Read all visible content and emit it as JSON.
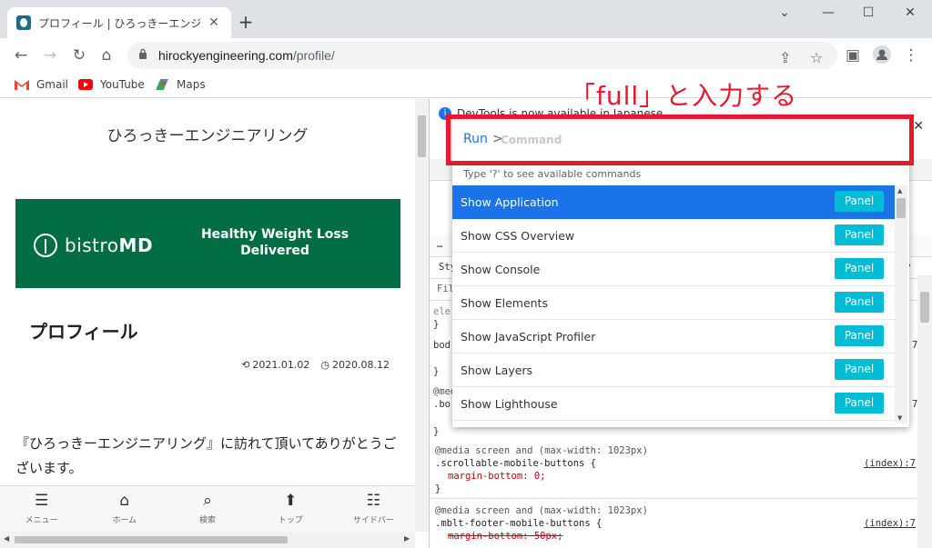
{
  "browser": {
    "tab_title": "プロフィール | ひろっきーエンジニアリング",
    "tab_close": "✕",
    "new_tab": "+",
    "win_minimize": "—",
    "win_maximize": "☐",
    "win_close": "✕",
    "win_dropdown": "⌄",
    "url_host": "hirockyengineering.com",
    "url_path": "/profile/",
    "bookmarks": [
      {
        "label": "Gmail"
      },
      {
        "label": "YouTube"
      },
      {
        "label": "Maps"
      }
    ]
  },
  "page": {
    "site_title": "ひろっきーエンジニアリング",
    "ad_brand_light": "bistro",
    "ad_brand_bold": "MD",
    "ad_tagline": "Healthy Weight Loss Delivered",
    "heading": "プロフィール",
    "date_updated": "2021.01.02",
    "date_published": "2020.08.12",
    "intro_text": "『ひろっきーエンジニアリング』に訪れて頂いてありがとうございます。",
    "mobile_nav": [
      {
        "icon": "☰",
        "label": "メニュー"
      },
      {
        "icon": "⌂",
        "label": "ホーム"
      },
      {
        "icon": "⌕",
        "label": "検索"
      },
      {
        "icon": "⬆",
        "label": "トップ"
      },
      {
        "icon": "☷",
        "label": "サイドバー"
      }
    ]
  },
  "devtools": {
    "info_text": "DevTools is now available in Japanese",
    "close": "✕",
    "css_blocks": [
      {
        "media": "@media screen and (max-width: 1023px)",
        "selector": ".scrollable-mobile-buttons {",
        "source": "(index):7",
        "prop": "margin-bottom: 0;",
        "close": "}"
      },
      {
        "media": "@media screen and (max-width: 1023px)",
        "selector": ".mblt-footer-mobile-buttons {",
        "source": "(index):7",
        "prop": "margin-bottom: 50px;"
      }
    ],
    "fragments": {
      "styles_tab": "Sty",
      "filter": "Filte",
      "ele": "ele",
      "brace": "}",
      "bod": "bod",
      "media_short": "@med",
      "bo": ".bo",
      "ty": "ty",
      "ln7a": "7",
      "ln7b": "7",
      "ellipsis": "…"
    }
  },
  "command_menu": {
    "prefix": "Run",
    "gt": ">",
    "placeholder": "Command",
    "hint": "Type '?' to see available commands",
    "items": [
      {
        "label": "Show Application",
        "badge": "Panel"
      },
      {
        "label": "Show CSS Overview",
        "badge": "Panel"
      },
      {
        "label": "Show Console",
        "badge": "Panel"
      },
      {
        "label": "Show Elements",
        "badge": "Panel"
      },
      {
        "label": "Show JavaScript Profiler",
        "badge": "Panel"
      },
      {
        "label": "Show Layers",
        "badge": "Panel"
      },
      {
        "label": "Show Lighthouse",
        "badge": "Panel"
      }
    ]
  },
  "annotation": {
    "text": "「full」と入力する",
    "color": "#e8192c"
  },
  "colors": {
    "accent": "#1a73e8",
    "panel_badge": "#00bcd4",
    "ad_green": "#016d45"
  }
}
